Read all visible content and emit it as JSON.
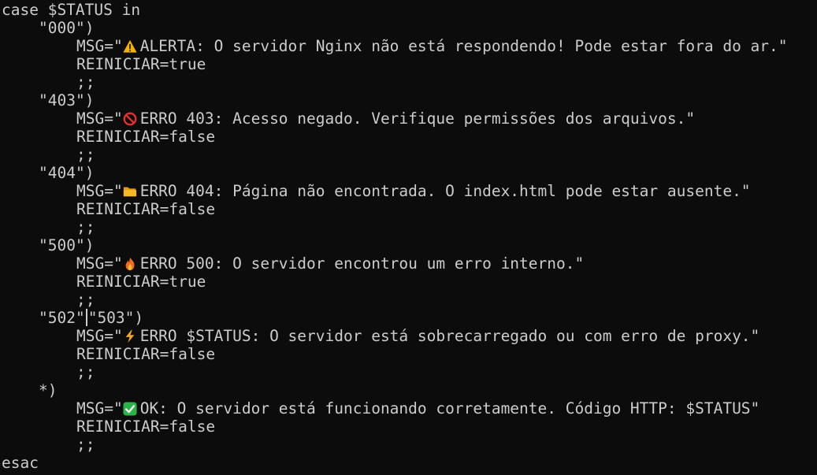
{
  "terminal": {
    "lines": {
      "case_open": "case $STATUS in",
      "c000_pat": "\"000\")",
      "c000_msg_pre": "MSG=\"",
      "c000_msg_text": "ALERTA: O servidor Nginx não está respondendo! Pode estar fora do ar.\"",
      "c000_rein": "REINICIAR=true",
      "c000_end": ";;",
      "c403_pat": "\"403\")",
      "c403_msg_pre": "MSG=\"",
      "c403_msg_text": "ERRO 403: Acesso negado. Verifique permissões dos arquivos.\"",
      "c403_rein": "REINICIAR=false",
      "c403_end": ";;",
      "c404_pat": "\"404\")",
      "c404_msg_pre": "MSG=\"",
      "c404_msg_text": "ERRO 404: Página não encontrada. O index.html pode estar ausente.\"",
      "c404_rein": "REINICIAR=false",
      "c404_end": ";;",
      "c500_pat": "\"500\")",
      "c500_msg_pre": "MSG=\"",
      "c500_msg_text": "ERRO 500: O servidor encontrou um erro interno.\"",
      "c500_rein": "REINICIAR=true",
      "c500_end": ";;",
      "c502_pat_a": "\"502\"",
      "c502_pat_b": "\"503\")",
      "c502_msg_pre": "MSG=\"",
      "c502_msg_text": "ERRO $STATUS: O servidor está sobrecarregado ou com erro de proxy.\"",
      "c502_rein": "REINICIAR=false",
      "c502_end": ";;",
      "cdef_pat": "*)",
      "cdef_msg_pre": "MSG=\"",
      "cdef_msg_text": "OK: O servidor está funcionando corretamente. Código HTTP: $STATUS\"",
      "cdef_rein": "REINICIAR=false",
      "cdef_end": ";;",
      "case_close": "esac"
    },
    "icons": {
      "c000": "warning-icon",
      "c403": "no-entry-icon",
      "c404": "folder-icon",
      "c500": "fire-icon",
      "c502": "lightning-icon",
      "cdef": "check-mark-icon"
    },
    "colors": {
      "background": "#0c0c0c",
      "foreground": "#cccccc"
    }
  }
}
